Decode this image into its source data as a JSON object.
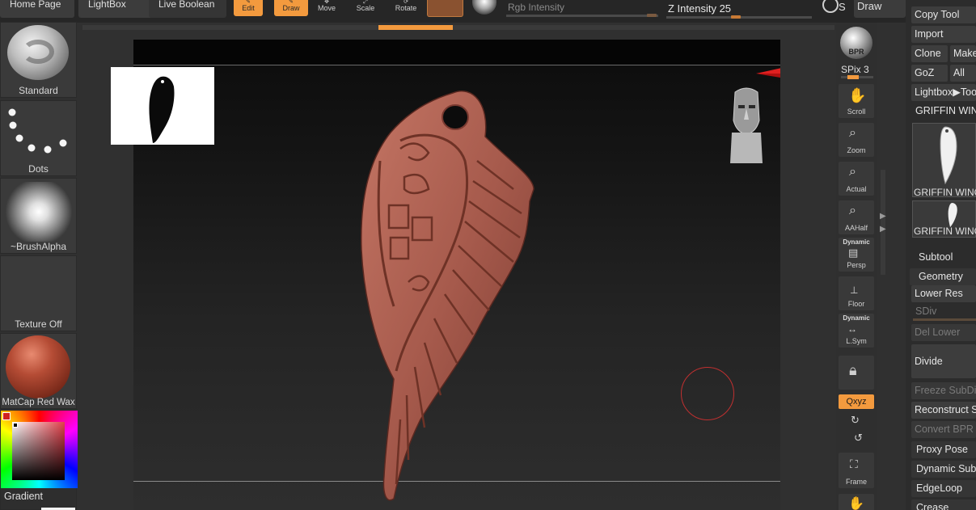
{
  "top_bar": {
    "home_page": "Home Page",
    "lightbox": "LightBox",
    "live_boolean": "Live Boolean",
    "edit": "Edit",
    "draw": "Draw",
    "move": "Move",
    "scale": "Scale",
    "rotate": "Rotate",
    "rgb_intensity": "Rgb Intensity",
    "z_intensity": "Z Intensity 25",
    "s_label": "S",
    "draw_right": "Draw"
  },
  "left_shelf": {
    "brush": "Standard",
    "stroke": "Dots",
    "alpha": "~BrushAlpha",
    "texture": "Texture Off",
    "material": "MatCap Red Wax",
    "gradient": "Gradient"
  },
  "right_strip": {
    "bpr": "BPR",
    "spix": "SPix 3",
    "scroll": "Scroll",
    "zoom": "Zoom",
    "actual": "Actual",
    "aahalf": "AAHalf",
    "dynamic_persp": "Dynamic",
    "persp": "Persp",
    "floor": "Floor",
    "dynamic_lsym": "Dynamic",
    "lsym": "L.Sym",
    "xyz": "Qxyz",
    "frame": "Frame"
  },
  "right_panel": {
    "copy_tool": "Copy Tool",
    "import": "Import",
    "clone": "Clone",
    "make": "Make",
    "goz": "GoZ",
    "all": "All",
    "lightbox_tool": "Lightbox▶Tool",
    "tool_name": "GRIFFIN WING",
    "thumb1_label": "GRIFFIN WING",
    "thumb2_label": "GRIFFIN WING",
    "subtool": "Subtool",
    "geometry": "Geometry",
    "lower_res": "Lower Res",
    "sdiv": "SDiv",
    "del_lower": "Del Lower",
    "divide": "Divide",
    "freeze_subdiv": "Freeze SubDiv",
    "reconstruct": "Reconstruct S",
    "convert_bpr": "Convert BPR T",
    "proxy_pose": "Proxy Pose",
    "dynamic_subdiv": "Dynamic Subdiv",
    "edgeloop": "EdgeLoop",
    "crease": "Crease"
  },
  "colors": {
    "accent": "#f39a3e",
    "model": "#a65a4c",
    "panel": "#3a3a3a"
  },
  "icons": [
    "hand-icon",
    "zoom-icon",
    "actual-icon",
    "aahalf-icon",
    "persp-icon",
    "floor-icon",
    "lsym-icon",
    "lock-icon",
    "rotate-cw-icon",
    "rotate-ccw-icon",
    "frame-icon",
    "gizmo-icon",
    "head-orient-icon"
  ]
}
